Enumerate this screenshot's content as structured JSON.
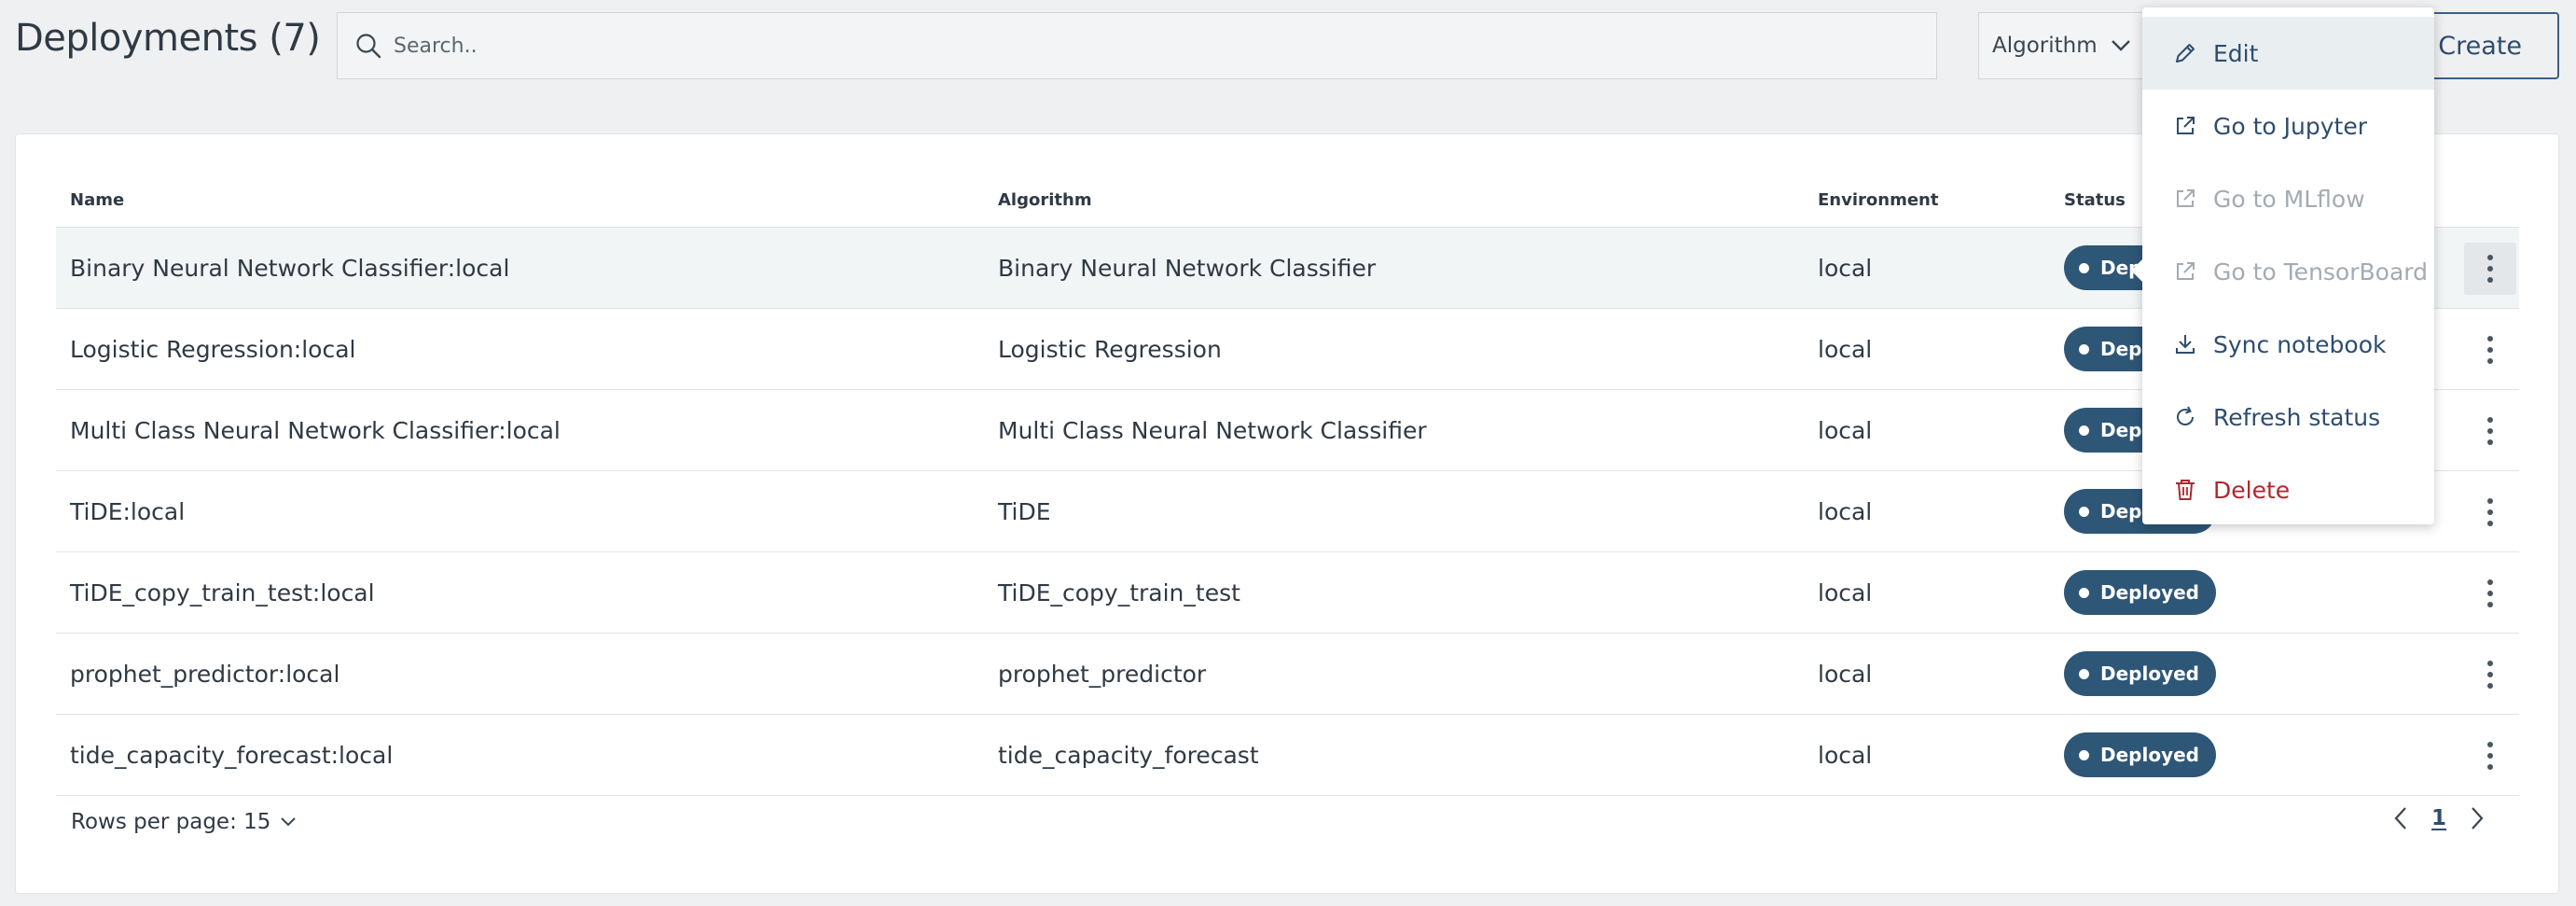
{
  "header": {
    "title": "Deployments (7)",
    "search_placeholder": "Search..",
    "filter_label": "Algorithm",
    "create_label": "Create"
  },
  "table": {
    "columns": [
      "Name",
      "Algorithm",
      "Environment",
      "Status"
    ],
    "rows": [
      {
        "name": "Binary Neural Network Classifier:local",
        "algorithm": "Binary Neural Network Classifier",
        "environment": "local",
        "status": "Deployed"
      },
      {
        "name": "Logistic Regression:local",
        "algorithm": "Logistic Regression",
        "environment": "local",
        "status": "Deployed"
      },
      {
        "name": "Multi Class Neural Network Classifier:local",
        "algorithm": "Multi Class Neural Network Classifier",
        "environment": "local",
        "status": "Deployed"
      },
      {
        "name": "TiDE:local",
        "algorithm": "TiDE",
        "environment": "local",
        "status": "Deployed"
      },
      {
        "name": "TiDE_copy_train_test:local",
        "algorithm": "TiDE_copy_train_test",
        "environment": "local",
        "status": "Deployed"
      },
      {
        "name": "prophet_predictor:local",
        "algorithm": "prophet_predictor",
        "environment": "local",
        "status": "Deployed"
      },
      {
        "name": "tide_capacity_forecast:local",
        "algorithm": "tide_capacity_forecast",
        "environment": "local",
        "status": "Deployed"
      }
    ]
  },
  "footer": {
    "rows_per_page": "Rows per page: 15",
    "page": "1"
  },
  "menu": {
    "items": [
      {
        "label": "Edit",
        "icon": "pencil-icon",
        "state": "hover"
      },
      {
        "label": "Go to Jupyter",
        "icon": "external-link-icon",
        "state": "enabled"
      },
      {
        "label": "Go to MLflow",
        "icon": "external-link-icon",
        "state": "disabled"
      },
      {
        "label": "Go to TensorBoard",
        "icon": "external-link-icon",
        "state": "disabled"
      },
      {
        "label": "Sync notebook",
        "icon": "download-icon",
        "state": "enabled"
      },
      {
        "label": "Refresh status",
        "icon": "refresh-icon",
        "state": "enabled"
      },
      {
        "label": "Delete",
        "icon": "trash-icon",
        "state": "danger"
      }
    ]
  },
  "colors": {
    "accent": "#2e4d6d",
    "badge": "#2e5677",
    "danger": "#b3262c",
    "disabled": "#a3abb2",
    "background": "#eff0f1"
  }
}
